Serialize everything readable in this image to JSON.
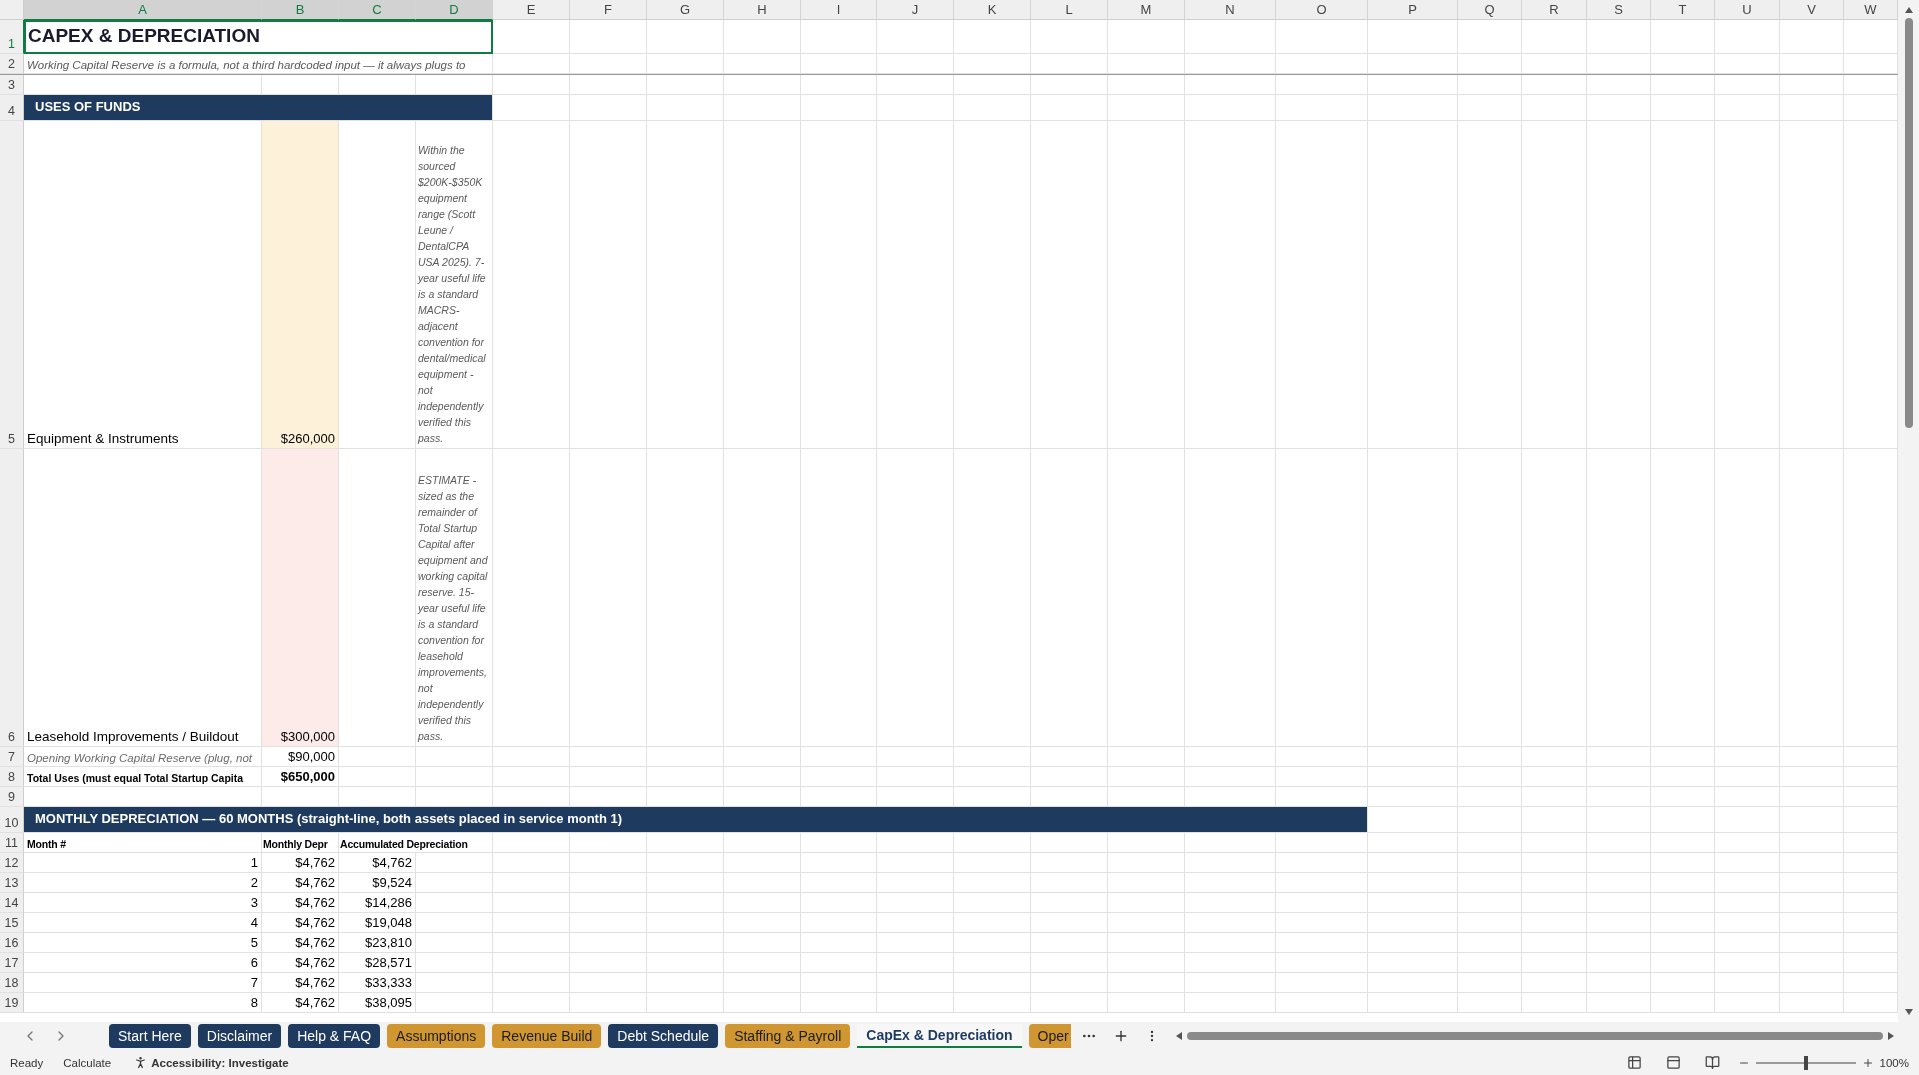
{
  "column_headers": [
    "A",
    "B",
    "C",
    "D",
    "E",
    "F",
    "G",
    "H",
    "I",
    "J",
    "K",
    "L",
    "M",
    "N",
    "O",
    "P",
    "Q",
    "R",
    "S",
    "T",
    "U",
    "V",
    "W"
  ],
  "row_numbers": [
    "1",
    "2",
    "3",
    "4",
    "5",
    "6",
    "7",
    "8",
    "9",
    "10",
    "11",
    "12",
    "13",
    "14",
    "15",
    "16",
    "17",
    "18",
    "19"
  ],
  "title": {
    "text": "CAPEX & DEPRECIATION",
    "selected": true
  },
  "subtitle": "Working Capital Reserve is a formula, not a third hardcoded input — it always plugs to",
  "uses_of_funds": {
    "heading": "USES OF FUNDS",
    "items": [
      {
        "kind": "input",
        "label": "Equipment & Instruments",
        "amount": "$260,000",
        "color": "#fdf2d9",
        "note": "Within the sourced $200K-$350K equipment range (Scott Leune / DentalCPA USA 2025). 7-year useful life is a standard MACRS-adjacent convention for dental/medical equipment - not independently verified this pass."
      },
      {
        "kind": "input",
        "label": "Leasehold Improvements / Buildout",
        "amount": "$300,000",
        "color": "#fcebe8",
        "note": "ESTIMATE - sized as the remainder of Total Startup Capital after equipment and working capital reserve. 15-year useful life is a standard convention for leasehold improvements, not independently verified this pass."
      },
      {
        "kind": "plug",
        "label": "Opening Working Capital Reserve (plug, not",
        "amount": "$90,000"
      },
      {
        "kind": "total",
        "label": "Total Uses (must equal Total Startup Capita",
        "amount": "$650,000"
      }
    ]
  },
  "depreciation": {
    "heading": "MONTHLY DEPRECIATION — 60 MONTHS (straight-line, both assets placed in service month 1)",
    "columns": [
      "Month #",
      "Monthly Depr",
      "Accumulated Depreciation"
    ],
    "rows": [
      [
        "1",
        "$4,762",
        "$4,762"
      ],
      [
        "2",
        "$4,762",
        "$9,524"
      ],
      [
        "3",
        "$4,762",
        "$14,286"
      ],
      [
        "4",
        "$4,762",
        "$19,048"
      ],
      [
        "5",
        "$4,762",
        "$23,810"
      ],
      [
        "6",
        "$4,762",
        "$28,571"
      ],
      [
        "7",
        "$4,762",
        "$33,333"
      ],
      [
        "8",
        "$4,762",
        "$38,095"
      ]
    ]
  },
  "sheet_tabs": [
    {
      "label": "Start Here",
      "color": "#1f3a5f",
      "selected": false
    },
    {
      "label": "Disclaimer",
      "color": "#1f3a5f",
      "selected": false
    },
    {
      "label": "Help & FAQ",
      "color": "#1f3a5f",
      "selected": false
    },
    {
      "label": "Assumptions",
      "color": "#cf9632",
      "selected": false
    },
    {
      "label": "Revenue Build",
      "color": "#cf9632",
      "selected": false
    },
    {
      "label": "Debt Schedule",
      "color": "#1f3a5f",
      "selected": false
    },
    {
      "label": "Staffing & Payroll",
      "color": "#cf9632",
      "selected": false
    },
    {
      "label": "CapEx & Depreciation",
      "color": "#1f3a5f",
      "selected": true
    },
    {
      "label": "Oper",
      "color": "#cf9632",
      "selected": false
    }
  ],
  "status_bar": {
    "ready": "Ready",
    "calculate": "Calculate",
    "accessibility": "Accessibility: Investigate",
    "zoom": {
      "level": 0.5,
      "reading": "100%"
    }
  }
}
